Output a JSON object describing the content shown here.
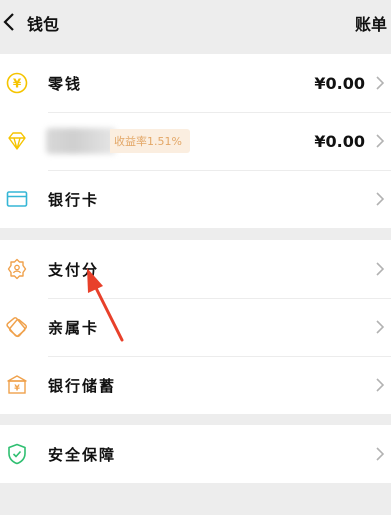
{
  "nav": {
    "title": "钱包",
    "bill": "账单"
  },
  "group1": {
    "change": {
      "label": "零钱",
      "amount": "¥0.00"
    },
    "licaitong": {
      "promo": "收益率1.51%",
      "amount": "¥0.00"
    },
    "bank_card": {
      "label": "银行卡"
    }
  },
  "group2": {
    "payscore": {
      "label": "支付分"
    },
    "family_card": {
      "label": "亲属卡"
    },
    "bank_savings": {
      "label": "银行储蓄"
    }
  },
  "group3": {
    "security": {
      "label": "安全保障"
    }
  },
  "colors": {
    "accent_yellow": "#f5c400",
    "accent_cyan": "#35b6d6",
    "accent_orange": "#f0a14b",
    "accent_green": "#2fbf71",
    "annotation_red": "#e8402a"
  }
}
